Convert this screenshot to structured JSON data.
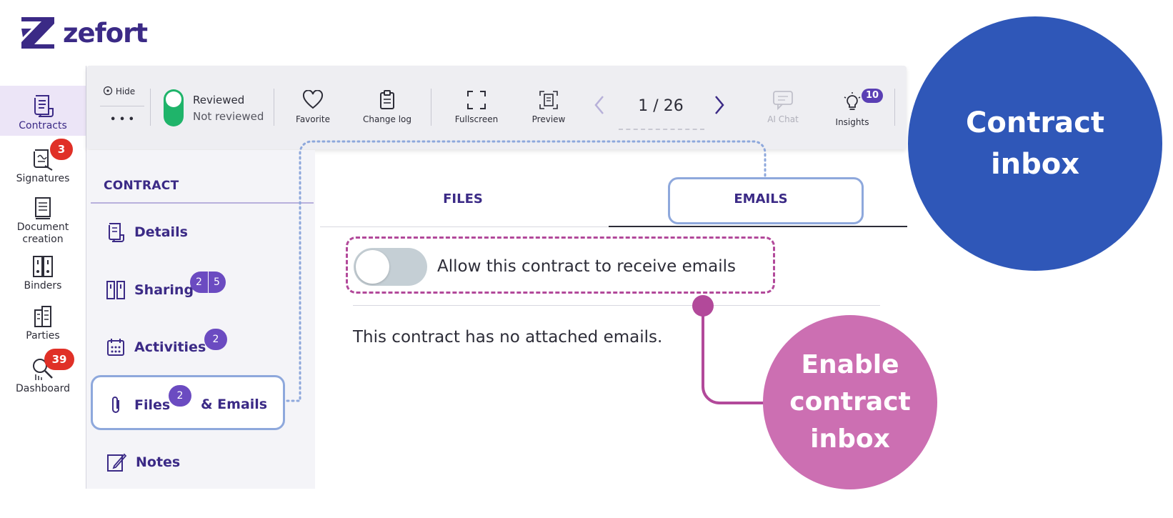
{
  "brand": {
    "name": "zefort",
    "color": "#3b2a86"
  },
  "left_nav": [
    {
      "label": "Contracts",
      "icon": "contract-scroll-icon",
      "active": true
    },
    {
      "label": "Signatures",
      "icon": "signature-icon",
      "badge": "3"
    },
    {
      "label": "Document creation",
      "label_line1": "Document",
      "label_line2": "creation",
      "icon": "document-icon"
    },
    {
      "label": "Binders",
      "icon": "binders-icon"
    },
    {
      "label": "Parties",
      "icon": "building-icon"
    },
    {
      "label": "Dashboard",
      "icon": "dashboard-search-icon",
      "badge": "39"
    }
  ],
  "toolbar": {
    "hide_label": "Hide",
    "more_label": "• • •",
    "review": {
      "reviewed": "Reviewed",
      "not_reviewed": "Not reviewed",
      "state": "reviewed"
    },
    "favorite": "Favorite",
    "change_log": "Change log",
    "fullscreen": "Fullscreen",
    "preview": "Preview",
    "pager": "1 / 26",
    "ai_chat": "AI Chat",
    "insights": "Insights",
    "insights_badge": "10"
  },
  "sidebar": {
    "heading": "CONTRACT",
    "items": [
      {
        "label": "Details",
        "icon": "details-scroll-icon"
      },
      {
        "label": "Sharing",
        "icon": "sharing-icon",
        "badge_a": "2",
        "badge_b": "5"
      },
      {
        "label": "Activities",
        "icon": "calendar-icon",
        "badge": "2"
      },
      {
        "label": "Files",
        "label_suffix": "& Emails",
        "icon": "paperclip-icon",
        "badge": "2",
        "selected": true
      },
      {
        "label": "Notes",
        "icon": "notes-icon"
      }
    ]
  },
  "main": {
    "tabs": [
      {
        "label": "FILES"
      },
      {
        "label": "EMAILS",
        "active": true
      }
    ],
    "toggle": {
      "label": "Allow this contract to receive emails",
      "on": false
    },
    "empty_message": "This contract has no attached emails."
  },
  "callouts": {
    "blue": {
      "line1": "Contract",
      "line2": "inbox",
      "color": "#2f57b8"
    },
    "pink": {
      "line1": "Enable",
      "line2": "contract",
      "line3": "inbox",
      "color": "#cc6fb2"
    }
  }
}
